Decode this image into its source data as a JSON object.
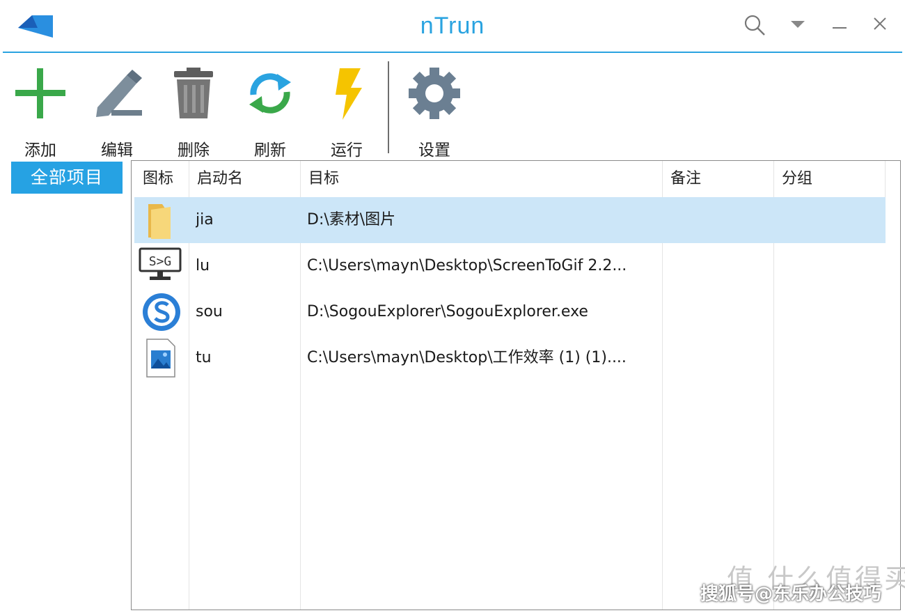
{
  "window": {
    "title": "nTrun",
    "controls": [
      "search-icon",
      "dropdown-icon",
      "minimize-icon",
      "close-icon"
    ]
  },
  "colors": {
    "accent": "#2aa3e0",
    "selection": "#cce6f8",
    "group_bg": "#26a2e3"
  },
  "toolbar": {
    "add_label": "添加",
    "edit_label": "编辑",
    "delete_label": "删除",
    "refresh_label": "刷新",
    "run_label": "运行",
    "settings_label": "设置"
  },
  "sidebar": {
    "groups": [
      {
        "label": "全部项目",
        "selected": true
      }
    ]
  },
  "list": {
    "columns": [
      "图标",
      "启动名",
      "目标",
      "备注",
      "分组"
    ],
    "rows": [
      {
        "icon": "folder-icon",
        "name": "jia",
        "target": "D:\\素材\\图片",
        "note": "",
        "group": "",
        "selected": true
      },
      {
        "icon": "screentogif-icon",
        "name": "lu",
        "target": "C:\\Users\\mayn\\Desktop\\ScreenToGif 2.2...",
        "note": "",
        "group": ""
      },
      {
        "icon": "sogou-browser-icon",
        "name": "sou",
        "target": "D:\\SogouExplorer\\SogouExplorer.exe",
        "note": "",
        "group": ""
      },
      {
        "icon": "image-file-icon",
        "name": "tu",
        "target": "C:\\Users\\mayn\\Desktop\\工作效率 (1) (1)....",
        "note": "",
        "group": ""
      }
    ]
  },
  "watermark": {
    "text": "搜狐号@东乐办公技巧",
    "bg_text": "值 什么值得买"
  }
}
